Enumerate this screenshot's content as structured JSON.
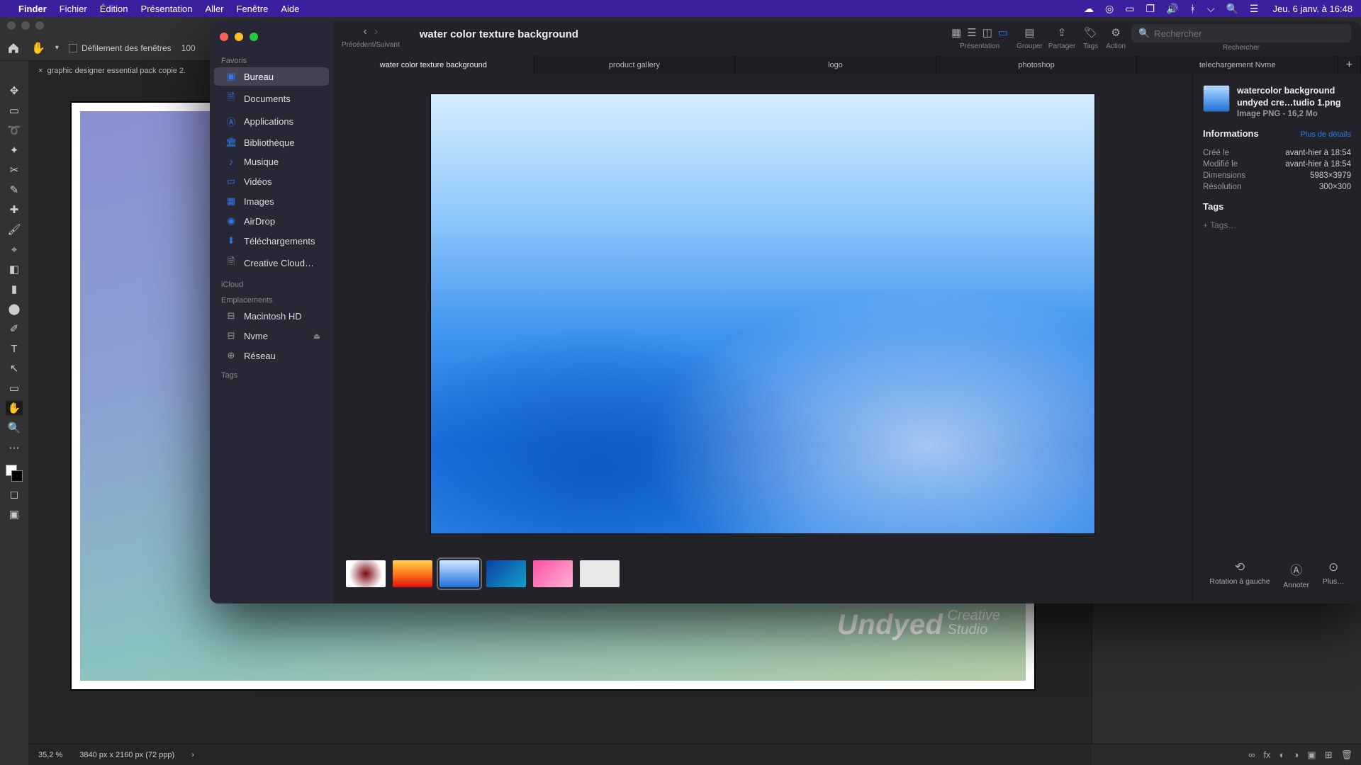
{
  "menubar": {
    "app": "Finder",
    "items": [
      "Fichier",
      "Édition",
      "Présentation",
      "Aller",
      "Fenêtre",
      "Aide"
    ],
    "clock": "Jeu. 6 janv. à 16:48"
  },
  "photoshop": {
    "optionbar": {
      "scroll_label": "Défilement des fenêtres",
      "zoom": "100"
    },
    "tab": "graphic designer essential pack copie 2.",
    "brand_main": "Undyed",
    "brand_sub1": "Creative",
    "brand_sub2": "Studio",
    "status_zoom": "35,2 %",
    "status_dims": "3840 px x 2160 px (72 ppp)"
  },
  "finder": {
    "nav_label": "Précédent/Suivant",
    "title": "water color texture background",
    "toolbar": {
      "view_label": "Présentation",
      "group_label": "Grouper",
      "share_label": "Partager",
      "tags_label": "Tags",
      "action_label": "Action",
      "search_label": "Rechercher",
      "search_placeholder": "Rechercher"
    },
    "sidebar": {
      "fav_header": "Favoris",
      "favorites": [
        "Bureau",
        "Documents",
        "Applications",
        "Bibliothèque",
        "Musique",
        "Vidéos",
        "Images",
        "AirDrop",
        "Téléchargements",
        "Creative Cloud…"
      ],
      "icloud_header": "iCloud",
      "locations_header": "Emplacements",
      "locations": [
        "Macintosh HD",
        "Nvme",
        "Réseau"
      ],
      "tags_header": "Tags"
    },
    "tabs": [
      "water color texture background",
      "product gallery",
      "logo",
      "photoshop",
      "telechargement Nvme"
    ],
    "info": {
      "filename_l1": "watercolor background",
      "filename_l2": "undyed cre…tudio 1.png",
      "meta": "Image PNG - 16,2 Mo",
      "info_header": "Informations",
      "more": "Plus de détails",
      "created_k": "Créé le",
      "created_v": "avant-hier à 18:54",
      "modified_k": "Modifié le",
      "modified_v": "avant-hier à 18:54",
      "dim_k": "Dimensions",
      "dim_v": "5983×3979",
      "res_k": "Résolution",
      "res_v": "300×300",
      "tags_header": "Tags",
      "tags_placeholder": "+ Tags…"
    },
    "actions": {
      "rotate": "Rotation à gauche",
      "annotate": "Annoter",
      "more": "Plus…"
    }
  }
}
